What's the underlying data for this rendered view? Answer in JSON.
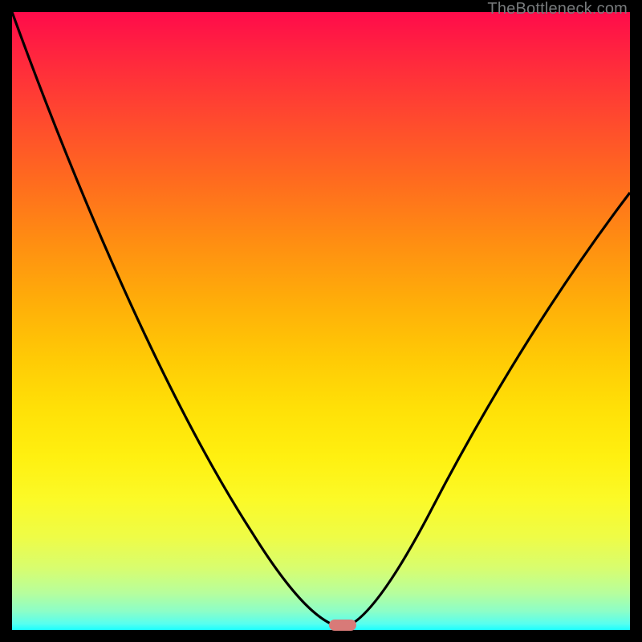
{
  "watermark": "TheBottleneck.com",
  "colors": {
    "frame": "#000000",
    "curve": "#000000",
    "marker": "#d87a78",
    "gradient_top": "#ff0b4b",
    "gradient_bottom": "#1cffff"
  },
  "chart_data": {
    "type": "line",
    "title": "",
    "xlabel": "",
    "ylabel": "",
    "xlim": [
      0,
      100
    ],
    "ylim": [
      0,
      100
    ],
    "series": [
      {
        "name": "bottleneck-curve",
        "x": [
          0,
          6,
          12,
          18,
          24,
          30,
          36,
          42,
          47,
          50,
          52,
          53.5,
          55,
          58,
          62,
          68,
          75,
          83,
          91,
          100
        ],
        "y": [
          100,
          87,
          74,
          62,
          50,
          39,
          29,
          19,
          10,
          4,
          1,
          0,
          1,
          4,
          10,
          19,
          31,
          44,
          57,
          71
        ]
      }
    ],
    "annotations": [
      {
        "name": "min-marker",
        "x": 53.5,
        "y": 0,
        "shape": "pill"
      }
    ]
  }
}
